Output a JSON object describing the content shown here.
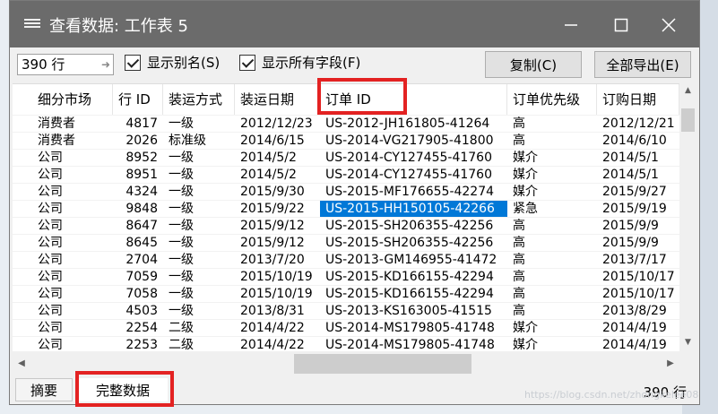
{
  "window": {
    "title": "查看数据: 工作表 5",
    "icon": "table-icon",
    "controls": {
      "minimize": "─",
      "maximize": "☐",
      "close": "✕"
    }
  },
  "toolbar": {
    "row_count_value": "390 行",
    "show_alias_label": "显示别名(S)",
    "show_alias_checked": true,
    "show_all_fields_label": "显示所有字段(F)",
    "show_all_fields_checked": true,
    "copy_label": "复制(C)",
    "export_all_label": "全部导出(E)"
  },
  "table": {
    "columns": [
      "细分市场",
      "行 ID",
      "装运方式",
      "装运日期",
      "订单 ID",
      "订单优先级",
      "订购日期"
    ],
    "rows": [
      [
        "消费者",
        "4817",
        "一级",
        "2012/12/23",
        "US-2012-JH161805-41264",
        "高",
        "2012/12/21"
      ],
      [
        "消费者",
        "2026",
        "标准级",
        "2014/6/15",
        "US-2014-VG217905-41800",
        "高",
        "2014/6/10"
      ],
      [
        "公司",
        "8952",
        "一级",
        "2014/5/2",
        "US-2014-CY127455-41760",
        "媒介",
        "2014/5/1"
      ],
      [
        "公司",
        "8951",
        "一级",
        "2014/5/2",
        "US-2014-CY127455-41760",
        "媒介",
        "2014/5/1"
      ],
      [
        "公司",
        "4324",
        "一级",
        "2015/9/30",
        "US-2015-MF176655-42274",
        "媒介",
        "2015/9/27"
      ],
      [
        "公司",
        "9848",
        "一级",
        "2015/9/22",
        "US-2015-HH150105-42266",
        "紧急",
        "2015/9/19"
      ],
      [
        "公司",
        "8647",
        "一级",
        "2015/9/12",
        "US-2015-SH206355-42256",
        "高",
        "2015/9/9"
      ],
      [
        "公司",
        "8645",
        "一级",
        "2015/9/12",
        "US-2015-SH206355-42256",
        "高",
        "2015/9/9"
      ],
      [
        "公司",
        "2704",
        "一级",
        "2013/7/20",
        "US-2013-GM146955-41472",
        "高",
        "2013/7/17"
      ],
      [
        "公司",
        "7059",
        "一级",
        "2015/10/19",
        "US-2015-KD166155-42294",
        "高",
        "2015/10/17"
      ],
      [
        "公司",
        "7058",
        "一级",
        "2015/10/19",
        "US-2015-KD166155-42294",
        "高",
        "2015/10/17"
      ],
      [
        "公司",
        "4503",
        "一级",
        "2013/8/31",
        "US-2013-KS163005-41515",
        "高",
        "2013/8/29"
      ],
      [
        "公司",
        "2254",
        "二级",
        "2014/4/22",
        "US-2014-MS179805-41748",
        "媒介",
        "2014/4/19"
      ],
      [
        "公司",
        "2253",
        "二级",
        "2014/4/22",
        "US-2014-MS179805-41748",
        "媒介",
        "2014/4/19"
      ]
    ],
    "selected_cell": {
      "row": 5,
      "column": 4
    }
  },
  "status": {
    "tab_summary": "摘要",
    "tab_full_data": "完整数据",
    "row_count": "390 行"
  },
  "watermark": "https://blog.csdn.net/zhongkelee08",
  "colors": {
    "titlebar": "#6b6b6b",
    "selection": "#0078d7",
    "highlight_box": "#e32222"
  }
}
